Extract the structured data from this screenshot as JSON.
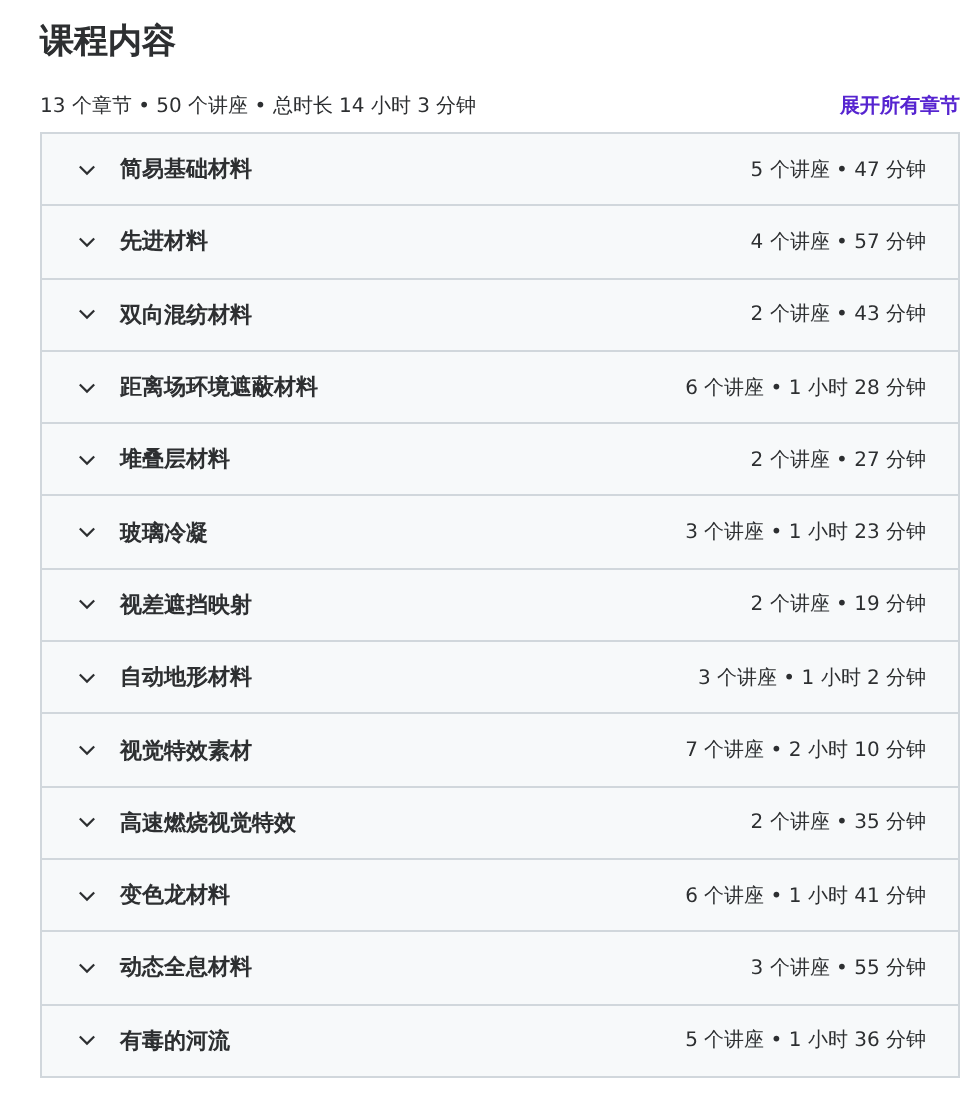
{
  "title": "课程内容",
  "summary": "13 个章节 • 50 个讲座 • 总时长 14 小时 3 分钟",
  "expand_all": "展开所有章节",
  "sections": [
    {
      "name": "简易基础材料",
      "meta": "5 个讲座 • 47 分钟",
      "expanded": false
    },
    {
      "name": "先进材料",
      "meta": "4 个讲座 • 57 分钟",
      "expanded": false
    },
    {
      "name": "双向混纺材料",
      "meta": "2 个讲座 • 43 分钟",
      "expanded": false
    },
    {
      "name": "距离场环境遮蔽材料",
      "meta": "6 个讲座 • 1 小时 28 分钟",
      "expanded": false
    },
    {
      "name": "堆叠层材料",
      "meta": "2 个讲座 • 27 分钟",
      "expanded": false
    },
    {
      "name": "玻璃冷凝",
      "meta": "3 个讲座 • 1 小时 23 分钟",
      "expanded": false
    },
    {
      "name": "视差遮挡映射",
      "meta": "2 个讲座 • 19 分钟",
      "expanded": false
    },
    {
      "name": "自动地形材料",
      "meta": "3 个讲座 • 1 小时 2 分钟",
      "expanded": false
    },
    {
      "name": "视觉特效素材",
      "meta": "7 个讲座 • 2 小时 10 分钟",
      "expanded": false
    },
    {
      "name": "高速燃烧视觉特效",
      "meta": "2 个讲座 • 35 分钟",
      "expanded": false
    },
    {
      "name": "变色龙材料",
      "meta": "6 个讲座 • 1 小时 41 分钟",
      "expanded": false
    },
    {
      "name": "动态全息材料",
      "meta": "3 个讲座 • 55 分钟",
      "expanded": false
    },
    {
      "name": "有毒的河流",
      "meta": "5 个讲座 • 1 小时 36 分钟",
      "expanded": false
    }
  ]
}
